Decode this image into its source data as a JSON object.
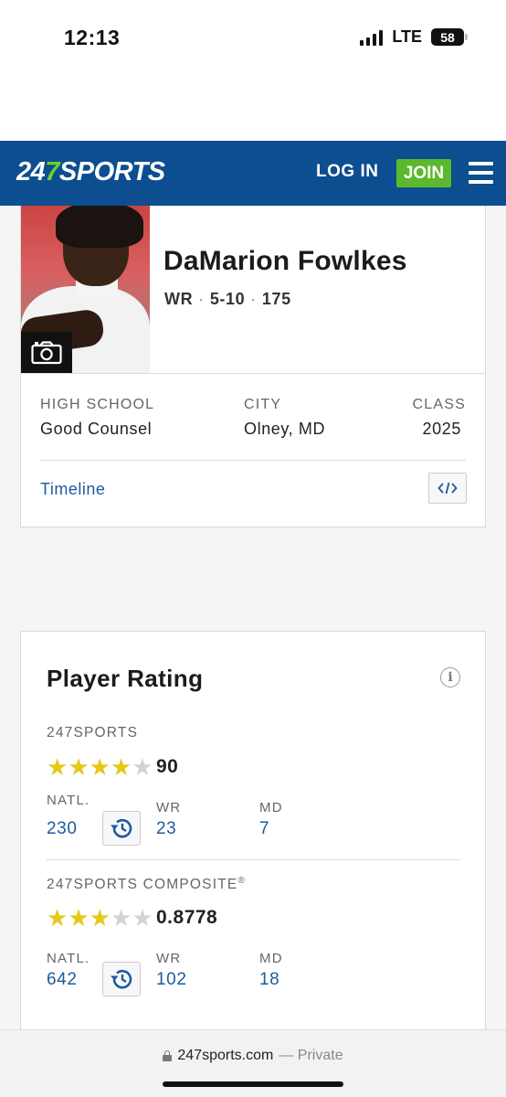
{
  "status_bar": {
    "time": "12:13",
    "network": "LTE",
    "battery": "58"
  },
  "header": {
    "logo_part1": "24",
    "logo_part2": "7",
    "logo_part3": "SPORTS",
    "login_label": "LOG IN",
    "join_label": "JOIN",
    "brand_color": "#0c4e8f",
    "join_color": "#5cb82c"
  },
  "player": {
    "name": "DaMarion Fowlkes",
    "position": "WR",
    "height": "5-10",
    "weight": "175",
    "separator": "·",
    "high_school_label": "HIGH SCHOOL",
    "high_school": "Good Counsel",
    "city_label": "CITY",
    "city": "Olney, MD",
    "class_label": "CLASS",
    "class": "2025",
    "timeline_label": "Timeline"
  },
  "rating": {
    "title": "Player Rating",
    "info_symbol": "i",
    "sports247": {
      "label": "247SPORTS",
      "stars": 4,
      "max_stars": 5,
      "score": "90",
      "natl_label": "NATL.",
      "natl_rank": "230",
      "pos_label": "WR",
      "pos_rank": "23",
      "state_label": "MD",
      "state_rank": "7"
    },
    "composite": {
      "label": "247SPORTS COMPOSITE",
      "trademark": "®",
      "stars": 3,
      "max_stars": 5,
      "score": "0.8778",
      "natl_label": "NATL.",
      "natl_rank": "642",
      "pos_label": "WR",
      "pos_rank": "102",
      "state_label": "MD",
      "state_rank": "18"
    }
  },
  "browser": {
    "domain": "247sports.com",
    "mode": "— Private"
  }
}
